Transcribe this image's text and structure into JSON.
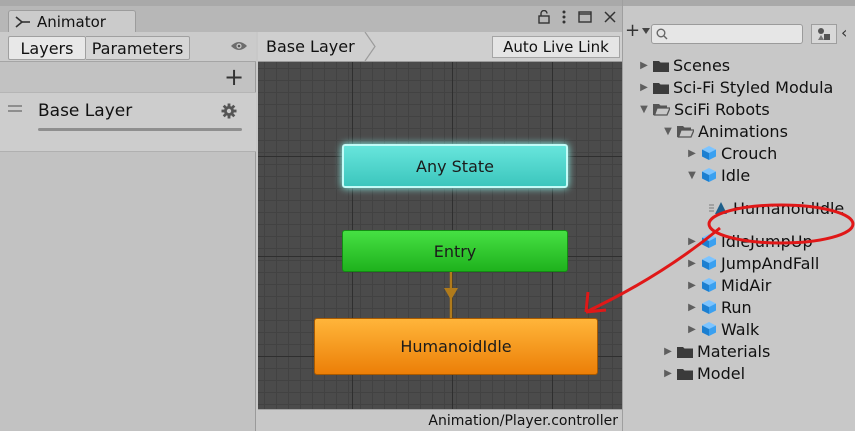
{
  "animator": {
    "tab_title": "Animator",
    "left_tabs": [
      "Layers",
      "Parameters"
    ],
    "layers": [
      {
        "name": "Base Layer"
      }
    ],
    "breadcrumb": "Base Layer",
    "auto_live_link": "Auto Live Link",
    "states": {
      "any_state": "Any State",
      "entry": "Entry",
      "default_state": "HumanoidIdle"
    },
    "status_path": "Animation/Player.controller"
  },
  "project": {
    "search": {
      "placeholder": ""
    },
    "tree": [
      {
        "label": "Scenes",
        "icon": "folder-icon",
        "level": 0,
        "expanded": false
      },
      {
        "label": "Sci-Fi Styled Modula",
        "icon": "folder-icon",
        "level": 0,
        "expanded": false
      },
      {
        "label": "SciFi Robots",
        "icon": "folder-open-icon",
        "level": 0,
        "expanded": true
      },
      {
        "label": "Animations",
        "icon": "folder-open-icon",
        "level": 1,
        "expanded": true
      },
      {
        "label": "Crouch",
        "icon": "model-prefab-icon",
        "level": 2,
        "expanded": false
      },
      {
        "label": "Idle",
        "icon": "model-prefab-icon",
        "level": 2,
        "expanded": true
      },
      {
        "label": "HumanoidIdle",
        "icon": "animation-clip-icon",
        "level": 3,
        "expanded": false
      },
      {
        "label": "IdleJumpUp",
        "icon": "model-prefab-icon",
        "level": 2,
        "expanded": false
      },
      {
        "label": "JumpAndFall",
        "icon": "model-prefab-icon",
        "level": 2,
        "expanded": false
      },
      {
        "label": "MidAir",
        "icon": "model-prefab-icon",
        "level": 2,
        "expanded": false
      },
      {
        "label": "Run",
        "icon": "model-prefab-icon",
        "level": 2,
        "expanded": false
      },
      {
        "label": "Walk",
        "icon": "model-prefab-icon",
        "level": 2,
        "expanded": false
      },
      {
        "label": "Materials",
        "icon": "folder-icon",
        "level": 1,
        "expanded": false
      },
      {
        "label": "Model",
        "icon": "folder-icon",
        "level": 1,
        "expanded": false
      }
    ]
  },
  "colors": {
    "any_state": "#4cd6cd",
    "entry": "#2fc92c",
    "default_state": "#f59a1c",
    "annotation": "#e01818"
  }
}
